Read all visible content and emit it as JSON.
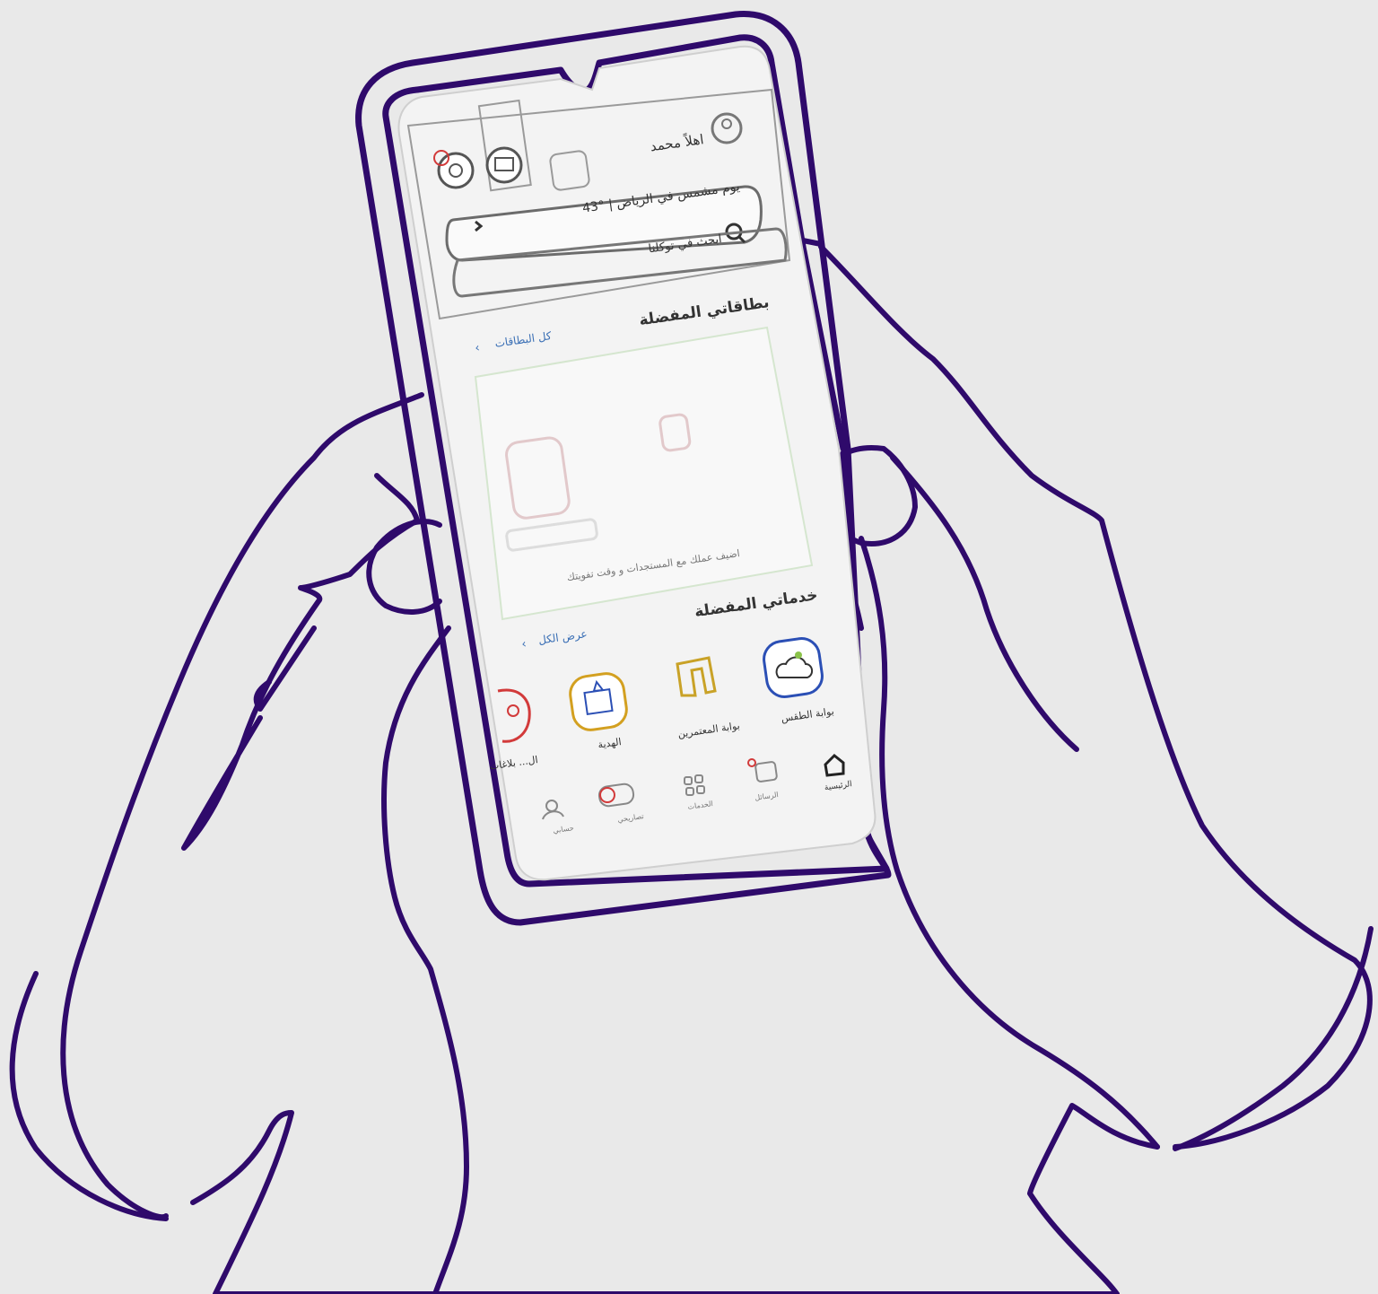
{
  "colors": {
    "outline": "#2f0a6b",
    "background": "#e9e9e9",
    "screen": "#f3f3f3",
    "link": "#3a6fb5",
    "weather_icon": "#2b4fb5",
    "box_icon": "#d3a020",
    "alert_red": "#d23a3a"
  },
  "header": {
    "user_name": "اهلاً محمد",
    "weather_line": "43° | يوم مشمس في الرياض"
  },
  "search": {
    "placeholder": "ابحث في توكلنا"
  },
  "cards_section": {
    "title": "بطاقاتي المفضلة",
    "see_all": "كل البطاقات",
    "empty_message": "اضيف عملك مع المستجدات و وقت تفويتك"
  },
  "services_section": {
    "title": "خدماتي المفضلة",
    "see_all": "عرض الكل",
    "items": [
      {
        "label": "بوابة الطقس",
        "icon": "weather-cloud-icon"
      },
      {
        "label": "بوابة المعتمرين",
        "icon": "n-logo-icon"
      },
      {
        "label": "الهدية",
        "icon": "gift-box-icon"
      },
      {
        "label": "ال... بلاغات",
        "icon": "red-service-icon"
      }
    ]
  },
  "bottom_nav": {
    "items": [
      {
        "label": "الرئيسية",
        "icon": "home-icon"
      },
      {
        "label": "الرسائل",
        "icon": "messages-icon"
      },
      {
        "label": "الخدمات",
        "icon": "grid-icon"
      },
      {
        "label": "تصاريحي",
        "icon": "permits-icon"
      },
      {
        "label": "حسابي",
        "icon": "profile-icon"
      }
    ]
  }
}
